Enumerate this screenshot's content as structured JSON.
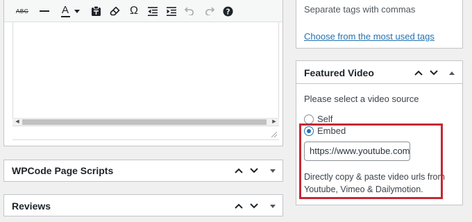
{
  "editor": {
    "toolbar": [
      {
        "icon": "strikethrough-icon",
        "glyph": "ABC"
      },
      {
        "icon": "horizontal-line-icon",
        "glyph": "—"
      },
      {
        "icon": "text-color-icon",
        "glyph": "A"
      },
      {
        "icon": "paste-as-text-icon",
        "glyph": ""
      },
      {
        "icon": "clear-formatting-icon",
        "glyph": ""
      },
      {
        "icon": "special-character-icon",
        "glyph": "Ω"
      },
      {
        "icon": "outdent-icon",
        "glyph": ""
      },
      {
        "icon": "indent-icon",
        "glyph": ""
      },
      {
        "icon": "undo-icon",
        "glyph": ""
      },
      {
        "icon": "redo-icon",
        "glyph": ""
      },
      {
        "icon": "help-icon",
        "glyph": "?"
      }
    ]
  },
  "wpcode_box": {
    "title": "WPCode Page Scripts"
  },
  "reviews_box": {
    "title": "Reviews"
  },
  "tags_box": {
    "help": "Separate tags with commas",
    "link": "Choose from the most used tags"
  },
  "featured_video": {
    "title": "Featured Video",
    "prompt": "Please select a video source",
    "options": [
      {
        "label": "Self",
        "checked": false
      },
      {
        "label": "Embed",
        "checked": true
      }
    ],
    "url_value": "https://www.youtube.com",
    "help": "Directly copy & paste video urls from Youtube, Vimeo & Dailymotion.",
    "highlight_color": "#c22a33"
  },
  "colors": {
    "link": "#2271b1",
    "border": "#c3c4c7",
    "background": "#f0f0f1"
  }
}
